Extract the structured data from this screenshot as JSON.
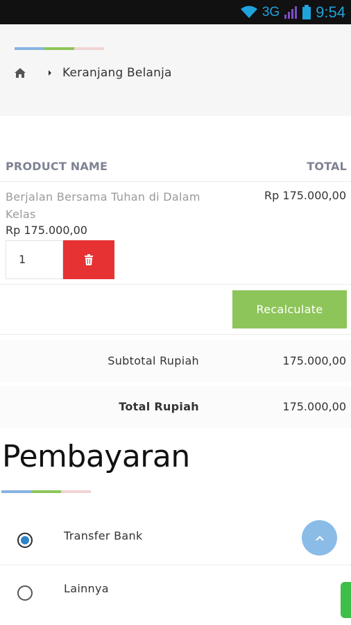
{
  "status_bar": {
    "network": "3G",
    "time": "9:54"
  },
  "breadcrumb": {
    "current": "Keranjang Belanja"
  },
  "cart": {
    "header_product": "PRODUCT NAME",
    "header_total": "TOTAL",
    "item": {
      "name": "Berjalan Bersama Tuhan di Dalam Kelas",
      "price": "Rp 175.000,00",
      "total": "Rp 175.000,00",
      "quantity": "1"
    },
    "recalculate_label": "Recalculate",
    "subtotal_label": "Subtotal Rupiah",
    "subtotal_value": "175.000,00",
    "total_label": "Total Rupiah",
    "total_value": "175.000,00"
  },
  "payment": {
    "title": "Pembayaran",
    "options": [
      {
        "label": "Transfer Bank",
        "selected": true
      },
      {
        "label": "Lainnya",
        "selected": false
      }
    ]
  },
  "colors": {
    "accent_green": "#8ec55a",
    "delete_red": "#e63232",
    "accent_blue": "#86b4e0",
    "accent_pink": "#f1d3d3"
  },
  "icons": {
    "home": "home-icon",
    "chevron": "chevron-right-icon",
    "trash": "trash-icon",
    "scroll_top": "chevron-up-icon",
    "whatsapp": "whatsapp-icon"
  }
}
